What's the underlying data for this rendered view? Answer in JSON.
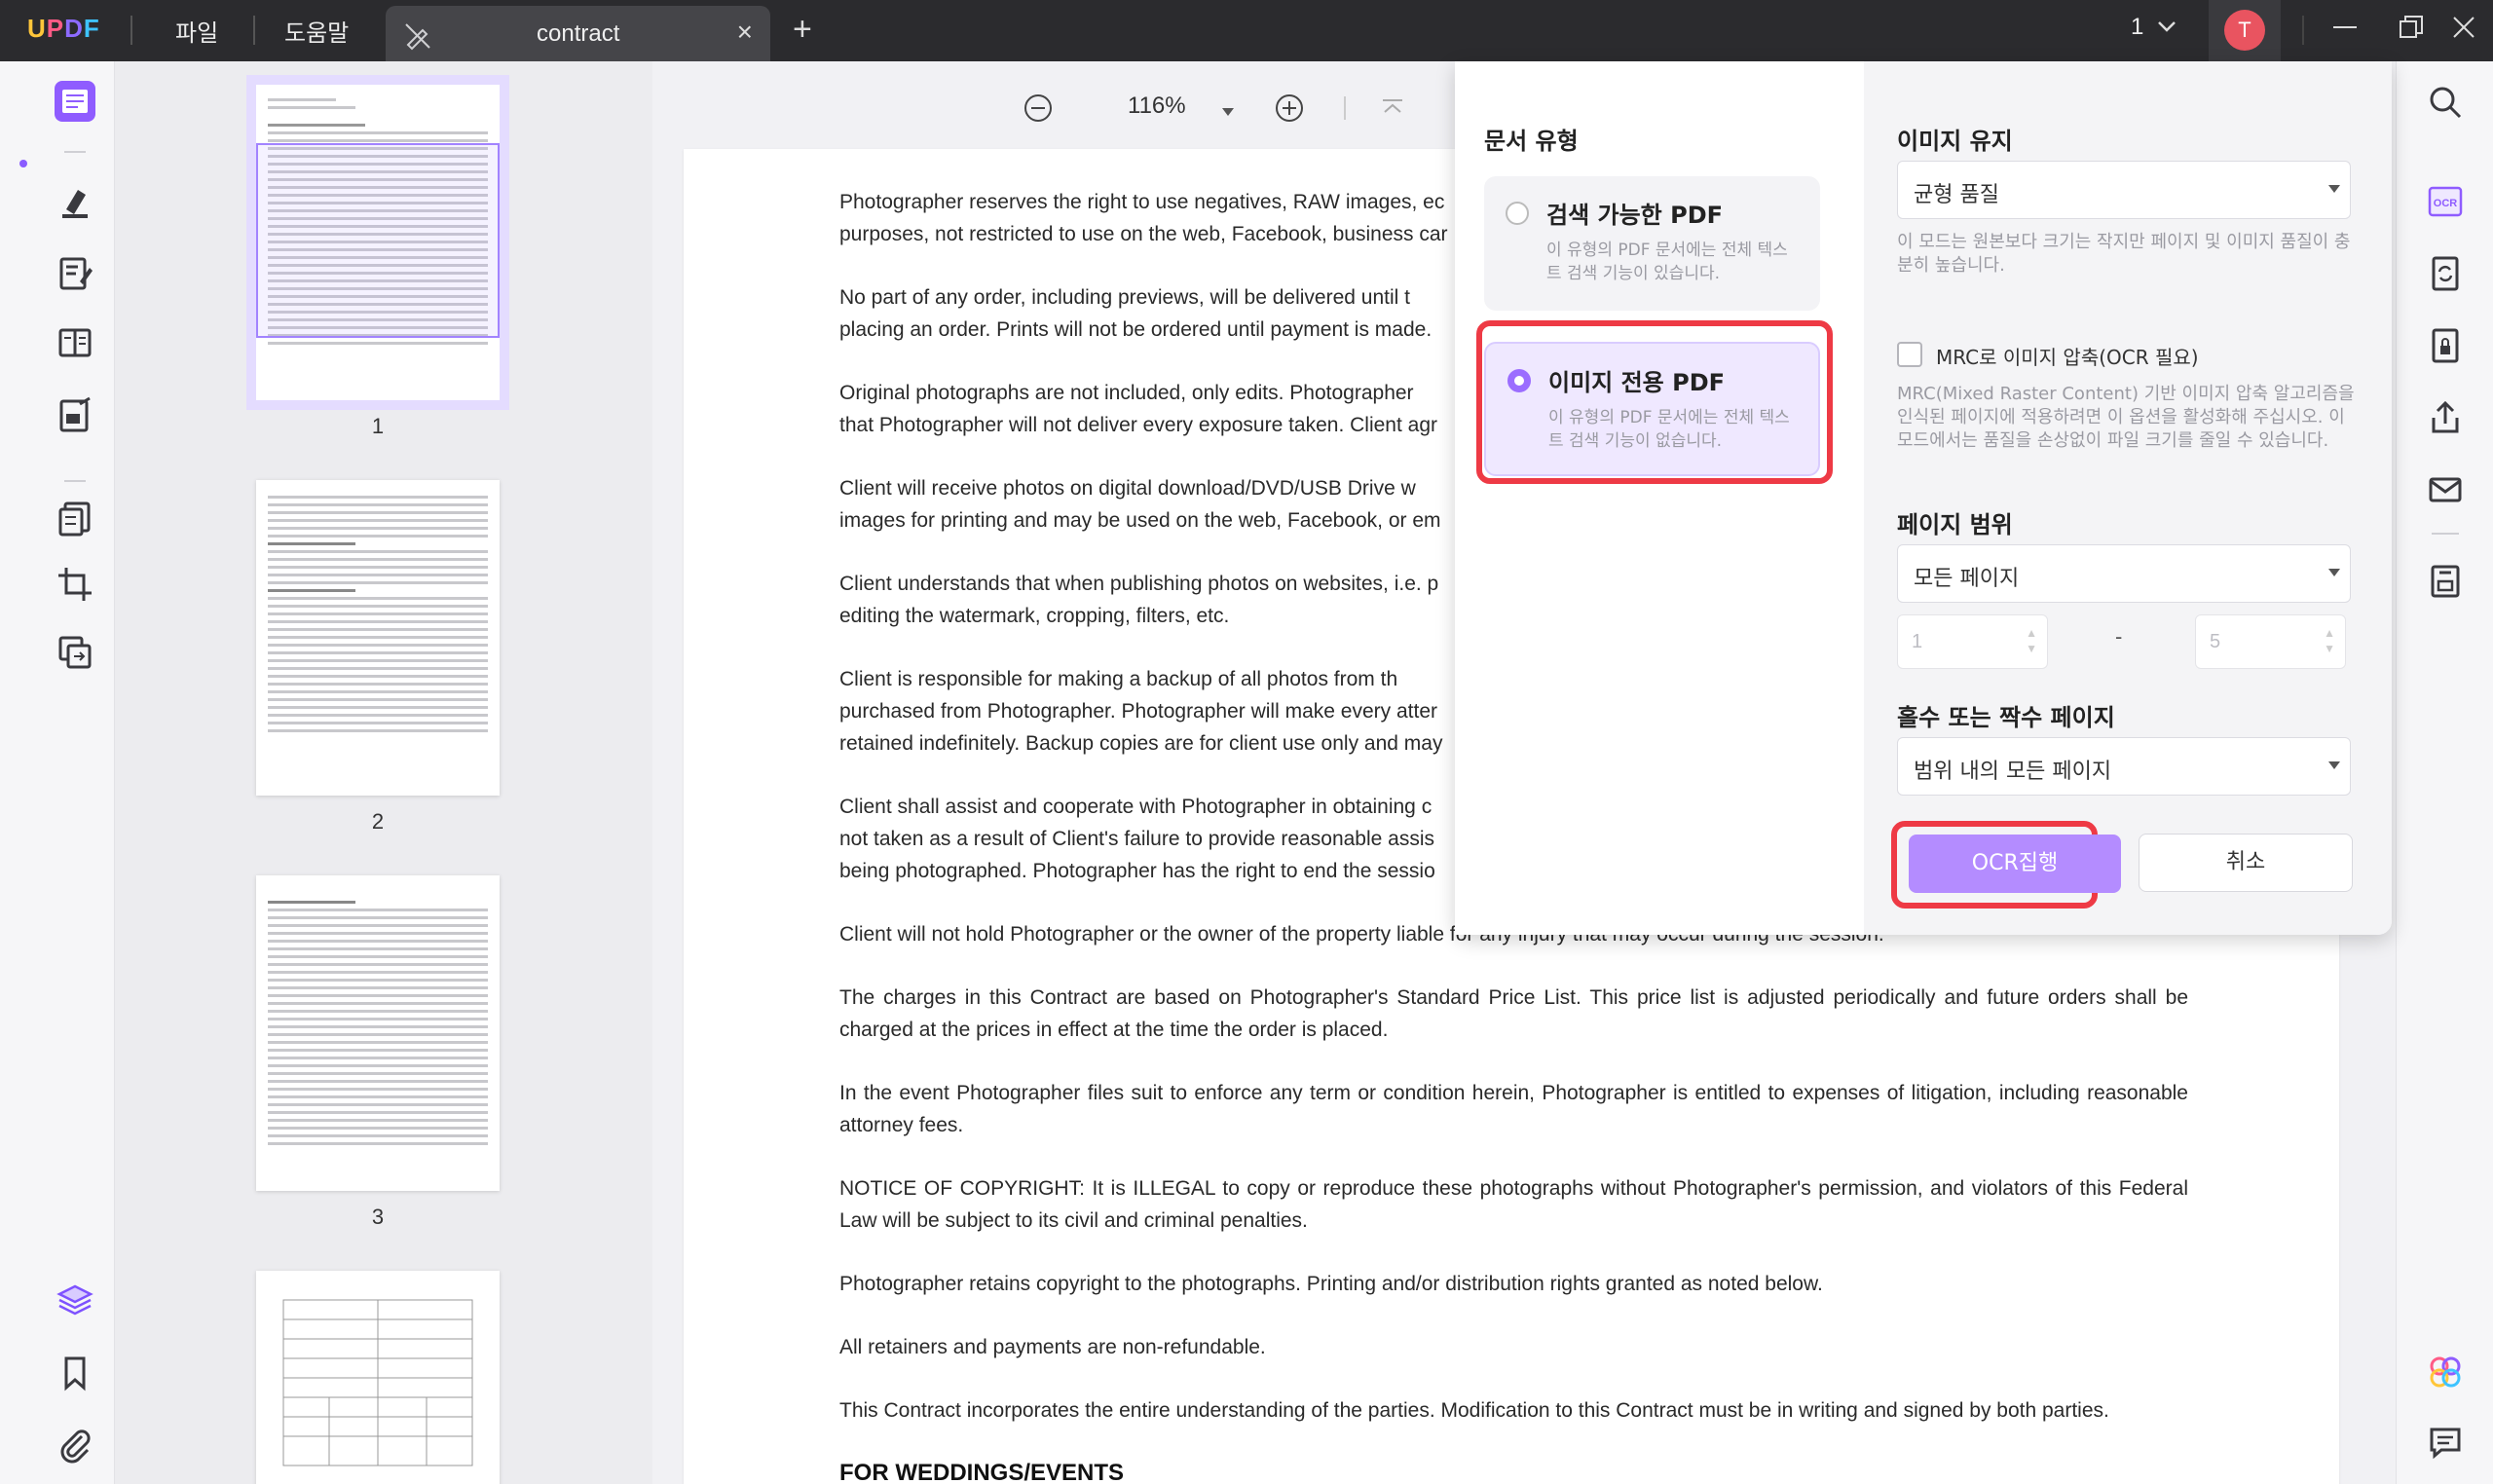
{
  "titlebar": {
    "logo": "UPDF",
    "menu_file": "파일",
    "menu_help": "도움말",
    "tab_title": "contract",
    "page_count": "1",
    "avatar_letter": "T"
  },
  "toolbar": {
    "zoom": "116%"
  },
  "thumbnails": [
    {
      "label": "1"
    },
    {
      "label": "2"
    },
    {
      "label": "3"
    }
  ],
  "document": {
    "paragraphs": [
      "Photographer reserves the right to use negatives, RAW images, ec",
      "purposes, not restricted to use on the web, Facebook, business car",
      "No part of any order, including previews, will be delivered until t",
      "placing an order. Prints will not be ordered until payment is made.",
      "Original photographs are not included, only edits. Photographer",
      "that Photographer will not deliver every exposure taken. Client agr",
      "Client will receive photos on digital download/DVD/USB Drive w",
      "images for printing and may be used on the web, Facebook, or em",
      "Client understands that when publishing photos on websites, i.e. p",
      "editing the watermark, cropping, filters, etc.",
      "Client is responsible for making a backup of all photos from th",
      "purchased from Photographer. Photographer will make every atter",
      "retained indefinitely. Backup copies are for client use only and may",
      "Client shall assist and cooperate with Photographer in obtaining c",
      "not taken as a result of Client's failure to provide reasonable assis",
      "being photographed. Photographer has the right to end the sessio",
      "Client will not hold Photographer or the owner of the property liable for any injury that may occur during the session.",
      "The charges in this Contract are based on Photographer's Standard Price List. This price list is adjusted periodically and future orders shall be charged at the prices in effect at the time the order is placed.",
      "In the event Photographer files suit to enforce any term or condition herein, Photographer is entitled to expenses of litigation, including reasonable attorney fees.",
      "NOTICE OF COPYRIGHT: It is ILLEGAL to copy or reproduce these photographs without Photographer's permission, and violators of this Federal Law will be subject to its civil and criminal penalties.",
      "Photographer retains copyright to the photographs. Printing and/or distribution rights granted as noted below.",
      "All retainers and payments are non-refundable.",
      "This Contract incorporates the entire understanding of the parties. Modification to this Contract must be in writing and signed by both parties."
    ],
    "heading": "FOR WEDDINGS/EVENTS"
  },
  "ocr_panel": {
    "doc_type_title": "문서 유형",
    "option_searchable": {
      "title": "검색 가능한 PDF",
      "desc": "이 유형의 PDF 문서에는 전체 텍스트 검색 기능이 있습니다."
    },
    "option_image_only": {
      "title": "이미지 전용 PDF",
      "desc": "이 유형의 PDF 문서에는 전체 텍스트 검색 기능이 없습니다."
    },
    "image_keep_title": "이미지 유지",
    "image_keep_value": "균형 품질",
    "image_keep_hint": "이 모드는 원본보다 크기는 작지만 페이지 및 이미지 품질이 충분히 높습니다.",
    "mrc_label": "MRC로 이미지 압축(OCR 필요)",
    "mrc_hint": "MRC(Mixed Raster Content) 기반 이미지 압축 알고리즘을 인식된 페이지에 적용하려면 이 옵션을 활성화해 주십시오. 이 모드에서는 품질을 손상없이 파일 크기를 줄일 수 있습니다.",
    "page_range_title": "페이지 범위",
    "page_range_value": "모든 페이지",
    "range_from": "1",
    "range_dash": "-",
    "range_to": "5",
    "odd_even_title": "홀수 또는 짝수 페이지",
    "odd_even_value": "범위 내의 모든 페이지",
    "run_button": "OCR집행",
    "cancel_button": "취소"
  },
  "colors": {
    "accent": "#9b6dff",
    "highlight_red": "#ee3a45",
    "titlebar_bg": "#2b2b2e"
  }
}
